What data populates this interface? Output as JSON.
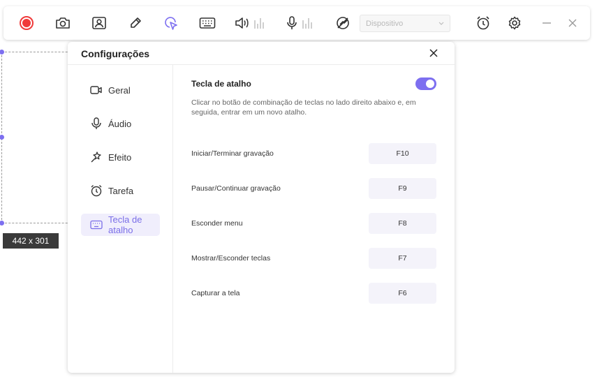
{
  "selection": {
    "size_label": "442 x 301"
  },
  "toolbar": {
    "buttons": [
      {
        "icon": "record-icon"
      },
      {
        "icon": "camera-icon"
      },
      {
        "icon": "webcam-icon"
      },
      {
        "icon": "pen-icon"
      },
      {
        "icon": "cursor-click-icon"
      },
      {
        "icon": "keyboard-icon"
      },
      {
        "icon": "speaker-icon"
      },
      {
        "icon": "microphone-icon"
      },
      {
        "icon": "mic-off-icon"
      },
      {
        "icon": "alarm-icon"
      },
      {
        "icon": "gear-icon"
      },
      {
        "icon": "minimize-icon"
      },
      {
        "icon": "close-icon"
      }
    ],
    "device_placeholder": "Dispositivo"
  },
  "dialog": {
    "title": "Configurações",
    "nav": [
      {
        "label": "Geral",
        "icon": "video-icon"
      },
      {
        "label": "Áudio",
        "icon": "microphone-icon"
      },
      {
        "label": "Efeito",
        "icon": "magic-wand-icon"
      },
      {
        "label": "Tarefa",
        "icon": "alarm-icon"
      },
      {
        "label": "Tecla de atalho",
        "icon": "keyboard-icon",
        "active": true
      }
    ],
    "section_title": "Tecla de atalho",
    "toggle_on": true,
    "description": "Clicar no botão de combinação de teclas no lado direito abaixo e, em seguida, entrar em um novo atalho.",
    "shortcuts": [
      {
        "label": "Iniciar/Terminar gravação",
        "key": "F10"
      },
      {
        "label": "Pausar/Continuar gravação",
        "key": "F9"
      },
      {
        "label": "Esconder menu",
        "key": "F8"
      },
      {
        "label": "Mostrar/Esconder teclas",
        "key": "F7"
      },
      {
        "label": "Capturar a tela",
        "key": "F6"
      }
    ]
  },
  "colors": {
    "accent": "#7d6ff0",
    "record": "#f03a3a"
  }
}
